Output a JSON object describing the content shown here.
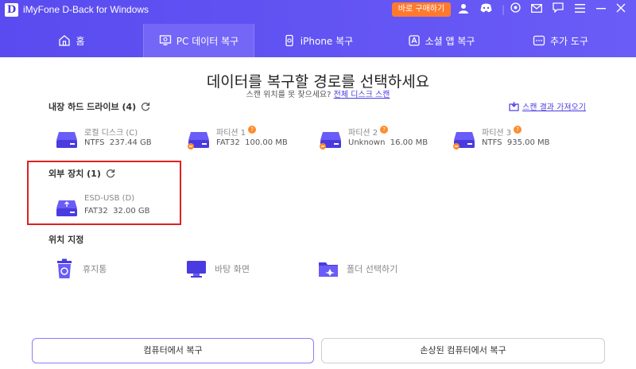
{
  "window": {
    "logo_letter": "D",
    "title": "iMyFone D-Back for Windows",
    "buy_label": "바로 구매하기"
  },
  "tabs": [
    {
      "label": "홈",
      "icon": "home-icon"
    },
    {
      "label": "PC 데이터 복구",
      "icon": "monitor-icon",
      "active": true
    },
    {
      "label": "iPhone 복구",
      "icon": "phone-icon"
    },
    {
      "label": "소셜 앱 복구",
      "icon": "app-icon"
    },
    {
      "label": "추가 도구",
      "icon": "tools-icon"
    }
  ],
  "main": {
    "heading": "데이터를 복구할 경로를 선택하세요",
    "sub_prefix": "스캔 위치를 못 찾으세요?",
    "sub_link": "전체 디스크 스캔",
    "load_scan_label": "스캔 결과 가져오기"
  },
  "internal": {
    "title": "내장 하드 드라이브 (4)",
    "drives": [
      {
        "name": "로컬 디스크 (C)",
        "fs": "NTFS",
        "size": "237.44 GB",
        "warn": false
      },
      {
        "name": "파티션 1",
        "fs": "FAT32",
        "size": "100.00 MB",
        "warn": true
      },
      {
        "name": "파티션 2",
        "fs": "Unknown",
        "size": "16.00 MB",
        "warn": true
      },
      {
        "name": "파티션 3",
        "fs": "NTFS",
        "size": "935.00 MB",
        "warn": true
      }
    ]
  },
  "external": {
    "title": "외부 장치 (1)",
    "drives": [
      {
        "name": "ESD-USB (D)",
        "fs": "FAT32",
        "size": "32.00 GB"
      }
    ]
  },
  "location": {
    "title": "위치 지정",
    "items": [
      {
        "label": "휴지통"
      },
      {
        "label": "바탕 화면"
      },
      {
        "label": "폴더 선택하기"
      }
    ]
  },
  "buttons": {
    "recover_computer": "컴퓨터에서 복구",
    "recover_damaged": "손상된 컴퓨터에서 복구"
  },
  "colors": {
    "accent": "#5a4bf0",
    "buy": "#ff7a2f",
    "warning": "#ff8a2a",
    "highlight": "#e02020"
  }
}
